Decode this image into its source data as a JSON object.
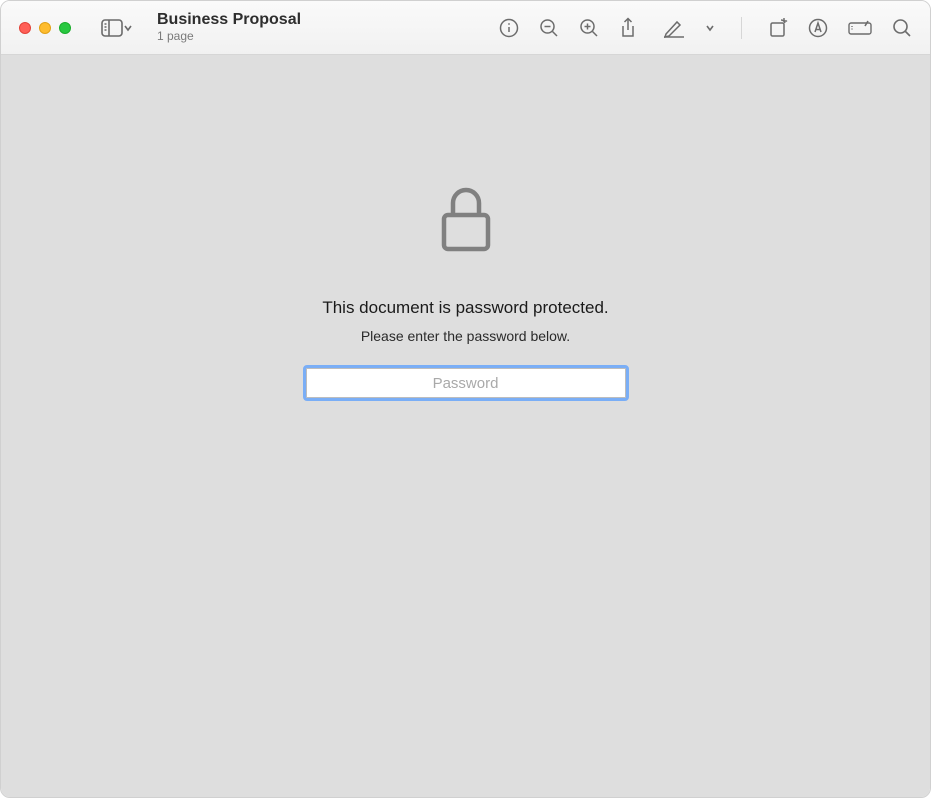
{
  "window": {
    "title": "Business Proposal",
    "subtitle": "1 page"
  },
  "prompt": {
    "heading": "This document is password protected.",
    "subtext": "Please enter the password below.",
    "placeholder": "Password"
  }
}
